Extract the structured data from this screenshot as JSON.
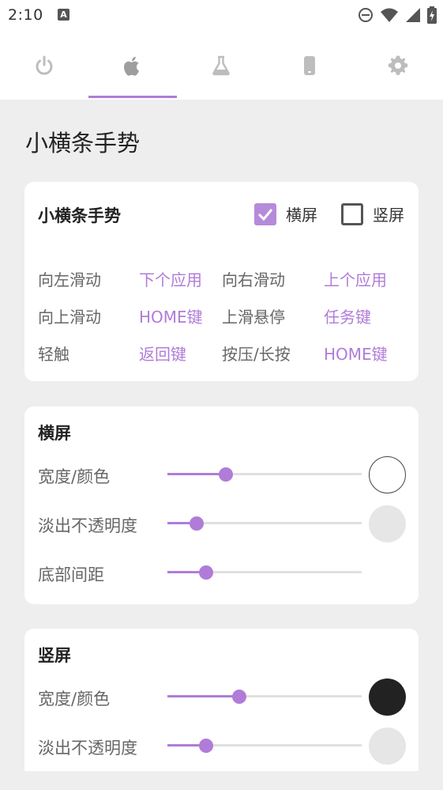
{
  "status_bar": {
    "time": "2:10",
    "notification_icon": "text-a-icon",
    "icons": [
      "dnd-icon",
      "wifi-icon",
      "signal-icon",
      "battery-icon"
    ]
  },
  "tabs": [
    {
      "icon": "power-icon",
      "selected": false
    },
    {
      "icon": "apple-icon",
      "selected": true
    },
    {
      "icon": "flask-icon",
      "selected": false
    },
    {
      "icon": "phone-icon",
      "selected": false
    },
    {
      "icon": "gear-icon",
      "selected": false
    }
  ],
  "accent_color": "#b07cd8",
  "page_title": "小横条手势",
  "gesture_card": {
    "title": "小横条手势",
    "landscape_label": "横屏",
    "landscape_checked": true,
    "portrait_label": "竖屏",
    "portrait_checked": false,
    "rows": [
      {
        "left_label": "向左滑动",
        "left_value": "下个应用",
        "right_label": "向右滑动",
        "right_value": "上个应用"
      },
      {
        "left_label": "向上滑动",
        "left_value": "HOME键",
        "right_label": "上滑悬停",
        "right_value": "任务键"
      },
      {
        "left_label": "轻触",
        "left_value": "返回键",
        "right_label": "按压/长按",
        "right_value": "HOME键"
      }
    ]
  },
  "landscape_card": {
    "title": "横屏",
    "width_color_label": "宽度/颜色",
    "width_value": 0.3,
    "color": "#ffffff",
    "fade_opacity_label": "淡出不透明度",
    "fade_opacity_value": 0.15,
    "fade_color": "#e6e6e6",
    "bottom_margin_label": "底部间距",
    "bottom_margin_value": 0.2
  },
  "portrait_card": {
    "title": "竖屏",
    "width_color_label": "宽度/颜色",
    "width_value": 0.37,
    "color": "#222222",
    "fade_opacity_label": "淡出不透明度",
    "fade_opacity_value": 0.2,
    "fade_color": "#e6e6e6"
  }
}
